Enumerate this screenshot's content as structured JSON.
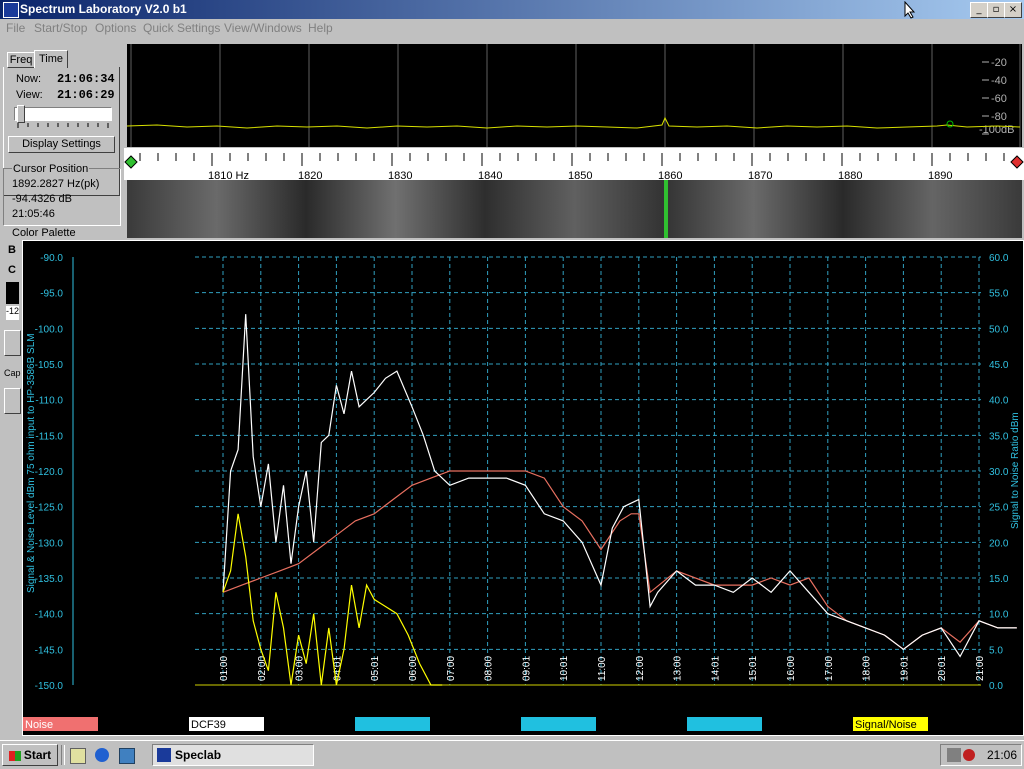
{
  "window": {
    "title": "Spectrum Laboratory V2.0 b1",
    "minimize": "_",
    "restore": "▫",
    "close": "×"
  },
  "menu": [
    "File",
    "Start/Stop",
    "Options",
    "Quick Settings",
    "View/Windows",
    "Help"
  ],
  "left_panel": {
    "tabs": [
      "Freq",
      "Time"
    ],
    "now_label": "Now:",
    "now_value": "21:06:34",
    "view_label": "View:",
    "view_value": "21:06:29",
    "display_settings": "Display Settings",
    "cursor_title": "Cursor Position",
    "cursor_freq": "1892.2827 Hz(pk)",
    "cursor_level": "-94.4326 dB",
    "cursor_time": "21:05:46",
    "color_palette": "Color Palette",
    "side_letters": [
      "B",
      "C"
    ],
    "side_value": "-12",
    "side_caption": "Cap"
  },
  "spectrum": {
    "db_labels": [
      "-20",
      "-40",
      "-60",
      "-80",
      "-100dB"
    ],
    "freq_labels": [
      "1810 Hz",
      "1820",
      "1830",
      "1840",
      "1850",
      "1860",
      "1870",
      "1880",
      "1890"
    ]
  },
  "chart_data": {
    "type": "line",
    "ylabel": "Signal & Noise Level dBm 75 ohm input to HP-3586B SLM",
    "ylabel_right": "Signal to Noise Ratio  dBm",
    "ylim": [
      -150,
      -90
    ],
    "ylim_right": [
      0,
      60
    ],
    "y_ticks": [
      "-90.0",
      "-95.0",
      "-100.0",
      "-105.0",
      "-110.0",
      "-115.0",
      "-120.0",
      "-125.0",
      "-130.0",
      "-135.0",
      "-140.0",
      "-145.0",
      "-150.0"
    ],
    "y_ticks_right": [
      "60.0",
      "55.0",
      "50.0",
      "45.0",
      "40.0",
      "35.0",
      "30.0",
      "25.0",
      "20.0",
      "15.0",
      "10.0",
      "5.0",
      "0.0"
    ],
    "x_ticks": [
      "01:00",
      "02:00",
      "03:00",
      "04:01",
      "05:01",
      "06:00",
      "07:00",
      "08:00",
      "09:01",
      "10:01",
      "11:00",
      "12:00",
      "13:00",
      "14:01",
      "15:01",
      "16:00",
      "17:00",
      "18:00",
      "19:01",
      "20:01",
      "21:00"
    ],
    "grid": true,
    "series": [
      {
        "name": "Noise",
        "color": "#e87060",
        "x": [
          0.0,
          0.5,
          1.0,
          1.5,
          2.0,
          2.5,
          3.0,
          3.5,
          4.0,
          4.5,
          5.0,
          5.5,
          6.0,
          7.0,
          8.0,
          8.5,
          9.0,
          9.5,
          10.0,
          10.5,
          10.8,
          11.0,
          11.3,
          12.0,
          13.0,
          14.0,
          14.5,
          15.0,
          15.5,
          16.0,
          16.5,
          17.0,
          17.5,
          18.0,
          18.5,
          19.0,
          19.5,
          20.0,
          20.5,
          21.0
        ],
        "values": [
          -137,
          -136,
          -135,
          -134,
          -133,
          -131,
          -129,
          -127,
          -126,
          -124,
          -122,
          -121,
          -120,
          -120,
          -120,
          -121,
          -125,
          -127,
          -131,
          -127,
          -126,
          -126,
          -137,
          -134,
          -136,
          -136,
          -135,
          -136,
          -135,
          -139,
          -141,
          -142,
          -143,
          -145,
          -143,
          -142,
          -144,
          -141,
          -142,
          -142
        ]
      },
      {
        "name": "DCF39",
        "color": "#ffffff",
        "x": [
          0.0,
          0.2,
          0.4,
          0.6,
          0.8,
          1.0,
          1.2,
          1.4,
          1.6,
          1.8,
          2.0,
          2.2,
          2.4,
          2.6,
          2.8,
          3.0,
          3.2,
          3.4,
          3.6,
          3.8,
          4.0,
          4.3,
          4.6,
          5.0,
          5.3,
          5.6,
          6.0,
          6.5,
          7.0,
          7.5,
          8.0,
          8.5,
          9.0,
          9.5,
          10.0,
          10.3,
          10.6,
          11.0,
          11.3,
          11.5,
          12.0,
          12.5,
          13.0,
          13.5,
          14.0,
          14.5,
          15.0,
          15.5,
          16.0,
          16.5,
          17.0,
          17.5,
          18.0,
          18.5,
          19.0,
          19.5,
          20.0,
          20.5,
          21.0
        ],
        "values": [
          -137,
          -120,
          -117,
          -98,
          -118,
          -125,
          -119,
          -130,
          -122,
          -133,
          -125,
          -120,
          -130,
          -116,
          -115,
          -108,
          -112,
          -106,
          -111,
          -110,
          -109,
          -107,
          -106,
          -111,
          -115,
          -120,
          -122,
          -121,
          -121,
          -121,
          -122,
          -126,
          -127,
          -130,
          -136,
          -128,
          -125,
          -124,
          -139,
          -137,
          -134,
          -136,
          -136,
          -137,
          -135,
          -137,
          -134,
          -137,
          -140,
          -141,
          -142,
          -143,
          -145,
          -143,
          -142,
          -146,
          -141,
          -142,
          -142
        ]
      },
      {
        "name": "Signal/Noise",
        "color": "#ffff00",
        "x": [
          0.0,
          0.2,
          0.4,
          0.6,
          0.8,
          1.0,
          1.2,
          1.4,
          1.6,
          1.8,
          2.0,
          2.2,
          2.4,
          2.6,
          2.8,
          3.0,
          3.2,
          3.4,
          3.6,
          3.8,
          4.0,
          4.3,
          4.6,
          4.9,
          5.2,
          5.5,
          5.8
        ],
        "values": [
          -137,
          -134,
          -126,
          -132,
          -141,
          -145,
          -148,
          -137,
          -142,
          -150,
          -143,
          -147,
          -140,
          -150,
          -142,
          -150,
          -145,
          -136,
          -142,
          -136,
          -138,
          -139,
          -140,
          -143,
          -147,
          -150,
          -150
        ]
      }
    ],
    "legend": [
      "Noise",
      "DCF39",
      "",
      "",
      "",
      "Signal/Noise"
    ]
  },
  "taskbar": {
    "start": "Start",
    "task": "Speclab",
    "clock": "21:06"
  }
}
